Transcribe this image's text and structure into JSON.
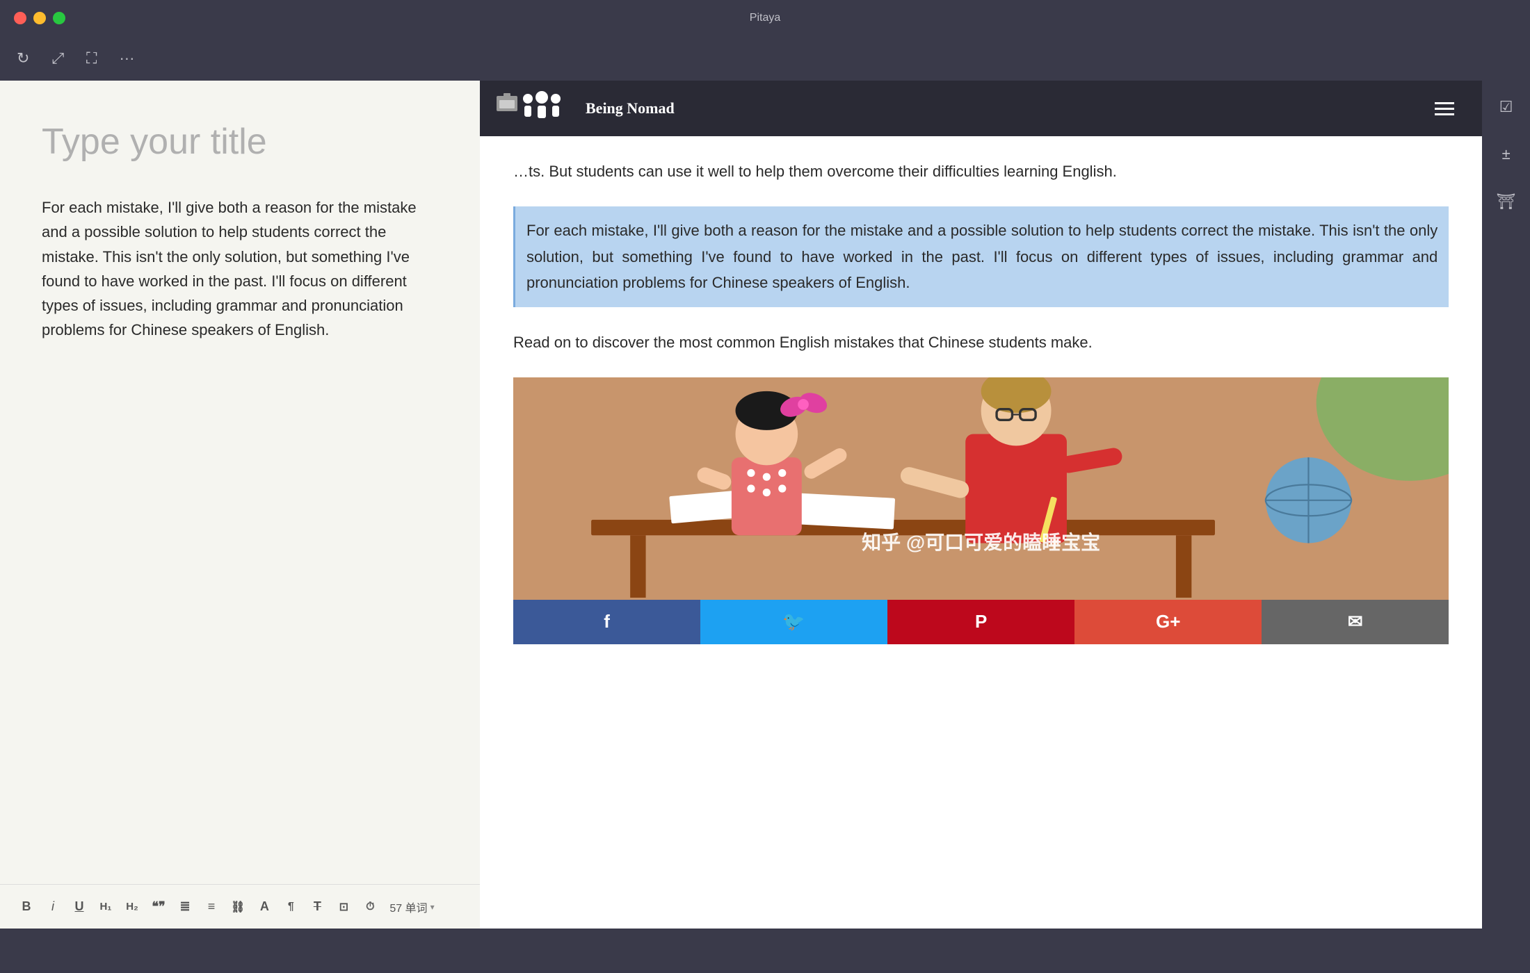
{
  "app": {
    "title": "Pitaya"
  },
  "titlebar": {
    "traffic_lights": [
      "red",
      "yellow",
      "green"
    ]
  },
  "toolbar": {
    "icons": [
      "refresh",
      "share",
      "fullscreen",
      "more"
    ]
  },
  "editor": {
    "title_placeholder": "Type your title",
    "body_text": "For each mistake, I'll give both a reason for the mistake and a possible solution to help students correct the mistake. This isn't the only solution, but something I've found to have worked in the past. I'll focus on different types of issues, including grammar and pronunciation problems for Chinese speakers of English."
  },
  "web": {
    "logo_text": "Being Nomad",
    "intro_text": "... ts. But students can use it well to help them overcome their difficulties learning English.",
    "highlighted_text": "For each mistake, I'll give both a reason for the mistake and a possible solution to help students correct the mistake. This isn't the only solution, but something I've found to have worked in the past. I'll focus on different types of issues, including grammar and pronunciation problems for Chinese speakers of English.",
    "read_on_text": "Read on to discover the most common English mistakes that Chinese students make.",
    "watermark": "知乎 @可口可爱的瞌睡宝宝"
  },
  "social": {
    "buttons": [
      {
        "label": "f",
        "color": "#3b5998"
      },
      {
        "label": "🐦",
        "color": "#1da1f2"
      },
      {
        "label": "P",
        "color": "#bd081c"
      },
      {
        "label": "G+",
        "color": "#dd4b39"
      },
      {
        "label": "✉",
        "color": "#666"
      }
    ]
  },
  "bottom_toolbar": {
    "bold_label": "B",
    "italic_label": "i",
    "underline_label": "U",
    "h1_label": "H₁",
    "h2_label": "H₂",
    "quote_label": "\"\"",
    "list_label": "≡",
    "link_label": "🔗",
    "text_label": "T",
    "format_label": "T̶",
    "strikethrough_label": "T̲",
    "image_label": "⬜",
    "clock_label": "⏱",
    "word_count": "57 单词"
  }
}
